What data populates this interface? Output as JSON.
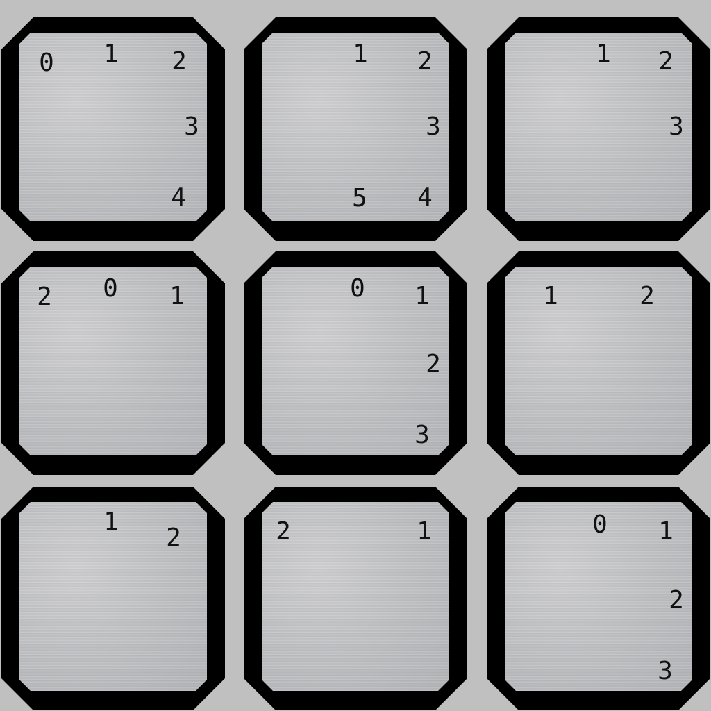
{
  "board": {
    "tiles": [
      {
        "numbers": [
          "0",
          "1",
          "2",
          "3",
          "4"
        ]
      },
      {
        "numbers": [
          "1",
          "2",
          "3",
          "5",
          "4"
        ]
      },
      {
        "numbers": [
          "1",
          "2",
          "3"
        ]
      },
      {
        "numbers": [
          "2",
          "0",
          "1"
        ]
      },
      {
        "numbers": [
          "0",
          "1",
          "2",
          "3"
        ]
      },
      {
        "numbers": [
          "1",
          "2"
        ]
      },
      {
        "numbers": [
          "1",
          "2"
        ]
      },
      {
        "numbers": [
          "2",
          "1"
        ]
      },
      {
        "numbers": [
          "0",
          "1",
          "2",
          "3"
        ]
      }
    ]
  },
  "colors": {
    "background": "#c0c0c0",
    "tile_border": "#000000",
    "tile_face": "#c4c5c8",
    "text": "#111111"
  }
}
